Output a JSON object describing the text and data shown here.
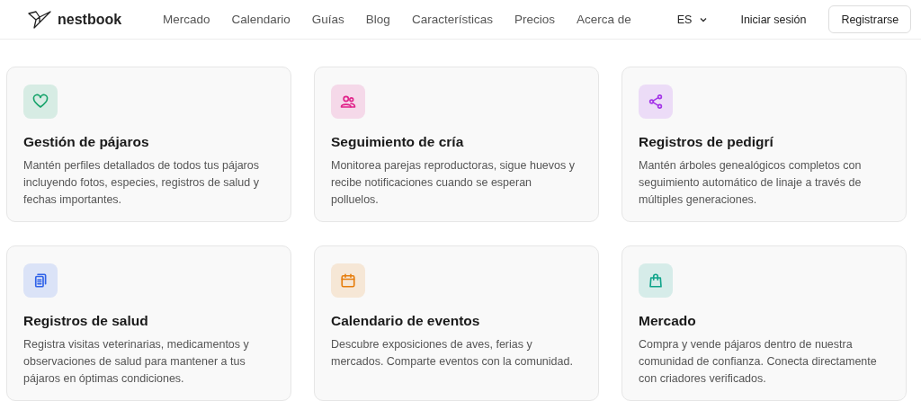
{
  "brand": "nestbook",
  "nav": [
    "Mercado",
    "Calendario",
    "Guías",
    "Blog",
    "Características",
    "Precios",
    "Acerca de"
  ],
  "language": "ES",
  "login": "Iniciar sesión",
  "signup": "Registrarse",
  "features": [
    {
      "kind": "heart",
      "color": "#16a36a",
      "title": "Gestión de pájaros",
      "text": "Mantén perfiles detallados de todos tus pájaros incluyendo fotos, especies, registros de salud y fechas importantes."
    },
    {
      "kind": "people",
      "color": "#e0238a",
      "title": "Seguimiento de cría",
      "text": "Monitorea parejas reproductoras, sigue huevos y recibe notificaciones cuando se esperan polluelos."
    },
    {
      "kind": "share",
      "color": "#a435e8",
      "title": "Registros de pedigrí",
      "text": "Mantén árboles genealógicos completos con seguimiento automático de linaje a través de múltiples generaciones."
    },
    {
      "kind": "clipboard",
      "color": "#2f62e8",
      "title": "Registros de salud",
      "text": "Registra visitas veterinarias, medicamentos y observaciones de salud para mantener a tus pájaros en óptimas condiciones."
    },
    {
      "kind": "calendar",
      "color": "#e67e0e",
      "title": "Calendario de eventos",
      "text": "Descubre exposiciones de aves, ferias y mercados. Comparte eventos con la comunidad."
    },
    {
      "kind": "bag",
      "color": "#10a48a",
      "title": "Mercado",
      "text": "Compra y vende pájaros dentro de nuestra comunidad de confianza. Conecta directamente con criadores verificados."
    }
  ]
}
